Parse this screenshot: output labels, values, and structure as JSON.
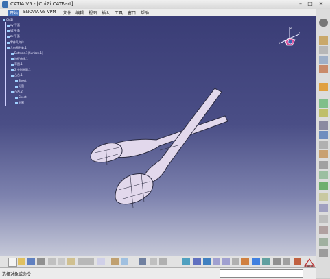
{
  "window": {
    "title": "CATIA V5 - [ChiZi.CATPart]"
  },
  "menubar": {
    "items": [
      "开始",
      "ENOVIA V5 VPM",
      "文件",
      "编辑",
      "视图",
      "插入",
      "工具",
      "窗口",
      "帮助"
    ],
    "active_index": 0
  },
  "tree": {
    "nodes": [
      {
        "label": "ChiZi"
      },
      {
        "label": "xy 平面"
      },
      {
        "label": "yz 平面"
      },
      {
        "label": "zx 平面"
      },
      {
        "label": "零件几何体"
      },
      {
        "label": "几何图形集.1"
      },
      {
        "label": "Extrude.1(Surface.1)"
      },
      {
        "label": "特征曲线.1"
      },
      {
        "label": "草图.1"
      },
      {
        "label": "2 分割曲面.1"
      },
      {
        "label": "凸台.1"
      },
      {
        "label": "Sheet"
      },
      {
        "label": "分割"
      },
      {
        "label": "凸台.2"
      },
      {
        "label": "Sheet"
      },
      {
        "label": "分割"
      }
    ]
  },
  "status": {
    "prompt": "选择对象或命令"
  },
  "logo": {
    "text": "CATIA"
  },
  "colors": {
    "viewport_top": "#3a3d76",
    "viewport_bottom": "#c5c8d8",
    "spoon_fill": "#e2d8ec",
    "spoon_edge": "#2a2a40",
    "active_menu": "#4a78c0"
  },
  "icons": {
    "right_toolbar": [
      "gear-icon",
      "sketch-icon",
      "pad-icon",
      "pocket-icon",
      "shaft-icon",
      "groove-icon",
      "hole-icon",
      "rib-icon",
      "slot-icon",
      "stiffener-icon",
      "loft-icon",
      "fillet-icon",
      "chamfer-icon",
      "draft-icon",
      "shell-icon",
      "thickness-icon",
      "thread-icon",
      "split-icon",
      "thick-surface-icon",
      "close-surface-icon",
      "sew-surface-icon",
      "translate-icon",
      "rotate-icon",
      "symmetry-icon",
      "mirror-icon",
      "pattern-icon",
      "scale-icon",
      "boolean-icon",
      "measure-icon",
      "constraint-icon"
    ],
    "bottom_toolbar": [
      "new-icon",
      "open-icon",
      "save-icon",
      "print-icon",
      "cut-icon",
      "copy-icon",
      "paste-icon",
      "undo-icon",
      "redo-icon",
      "help-icon",
      "formula-icon",
      "comment-icon",
      "catalog-icon",
      "table-icon",
      "sphere-icon",
      "layer-icon",
      "fit-all-icon",
      "pan-icon",
      "rotate-view-icon",
      "zoom-in-icon",
      "zoom-out-icon",
      "normal-view-icon",
      "iso-view-icon",
      "render-style-icon",
      "hide-show-icon",
      "swap-space-icon",
      "material-icon"
    ]
  }
}
